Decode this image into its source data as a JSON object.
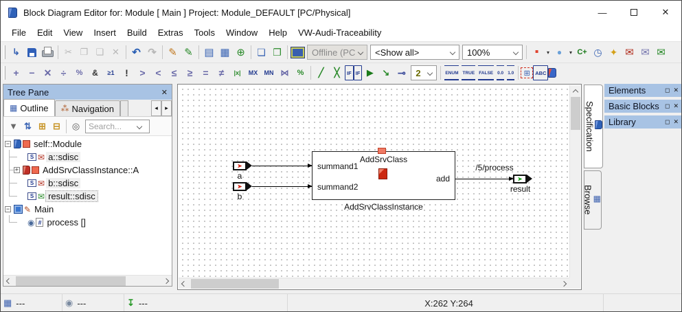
{
  "window": {
    "title": "Block Diagram Editor for: Module [ Main ] Project: Module_DEFAULT [PC/Physical]",
    "controls": {
      "minimize": "—",
      "close": "✕"
    }
  },
  "menu": {
    "items": [
      {
        "label": "File",
        "name": "menu-file"
      },
      {
        "label": "Edit",
        "name": "menu-edit"
      },
      {
        "label": "View",
        "name": "menu-view"
      },
      {
        "label": "Insert",
        "name": "menu-insert"
      },
      {
        "label": "Build",
        "name": "menu-build"
      },
      {
        "label": "Extras",
        "name": "menu-extras"
      },
      {
        "label": "Tools",
        "name": "menu-tools"
      },
      {
        "label": "Window",
        "name": "menu-window"
      },
      {
        "label": "Help",
        "name": "menu-help"
      },
      {
        "label": "VW-Audi-Traceability",
        "name": "menu-vw-audi-traceability"
      }
    ]
  },
  "toolbar_main": {
    "items_left": [
      {
        "cls": "grip",
        "name": "toolbar-grip",
        "act": "false"
      },
      {
        "cls": "tbi",
        "name": "show-in-browser-icon",
        "glyph": "↳",
        "style": "color:#3a64b4;font-weight:bold"
      },
      {
        "cls": "tbi ic-floppy",
        "name": "save-icon",
        "glyph": ""
      },
      {
        "cls": "tbi ic-print",
        "name": "print-icon",
        "glyph": ""
      },
      {
        "cls": "tbsep",
        "name": "toolbar-separator",
        "act": "false"
      },
      {
        "cls": "tbi dis",
        "name": "cut-icon",
        "glyph": "✂"
      },
      {
        "cls": "tbi dis",
        "name": "copy-icon",
        "glyph": "❐"
      },
      {
        "cls": "tbi dis",
        "name": "paste-icon",
        "glyph": "❏"
      },
      {
        "cls": "tbi dis",
        "name": "delete-icon",
        "glyph": "✕"
      },
      {
        "cls": "tbsep",
        "name": "toolbar-separator",
        "act": "false"
      },
      {
        "cls": "tbi",
        "name": "undo-icon",
        "glyph": "↶",
        "style": "color:#2a5fb4;font-weight:bold;font-size:15px"
      },
      {
        "cls": "tbi dis",
        "name": "redo-icon",
        "glyph": "↷",
        "style": "font-weight:bold;font-size:15px"
      },
      {
        "cls": "tbsep",
        "name": "toolbar-separator",
        "act": "false"
      },
      {
        "cls": "tbi",
        "name": "edit-component-icon",
        "glyph": "✎",
        "style": "color:#c07820;font-size:15px"
      },
      {
        "cls": "tbi",
        "name": "edit-data-icon",
        "glyph": "✎",
        "style": "color:#2a8a2a;font-size:15px"
      },
      {
        "cls": "tbsep",
        "name": "toolbar-separator",
        "act": "false"
      },
      {
        "cls": "tbi",
        "name": "add-database-item-icon",
        "glyph": "▤",
        "style": "color:#3a64b4;font-size:15px"
      },
      {
        "cls": "tbi",
        "name": "add-module-icon",
        "glyph": "▦",
        "style": "color:#3a64b4;font-size:15px"
      },
      {
        "cls": "tbi",
        "name": "add-class-icon",
        "glyph": "⊕",
        "style": "color:#2a8a2a;font-size:15px"
      },
      {
        "cls": "tbsep",
        "name": "toolbar-separator",
        "act": "false"
      },
      {
        "cls": "tbi",
        "name": "open-specification-icon",
        "glyph": "❏",
        "style": "color:#3a64b4;font-size:14px"
      },
      {
        "cls": "tbi",
        "name": "generate-code-icon",
        "glyph": "❐",
        "style": "color:#2a8a2a;font-size:14px"
      },
      {
        "cls": "tbsep",
        "name": "toolbar-separator",
        "act": "false"
      },
      {
        "cls": "tbi ic-monitor",
        "name": "experiment-monitor-icon",
        "glyph": ""
      }
    ],
    "combos": {
      "target": {
        "value": "Offline (PC",
        "name": "experiment-target-combo"
      },
      "filter": {
        "value": "<Show all>",
        "name": "filter-combo"
      },
      "zoom": {
        "value": "100%",
        "name": "zoom-combo"
      }
    },
    "items_right": [
      {
        "cls": "tbsep",
        "name": "toolbar-separator",
        "act": "false"
      },
      {
        "cls": "tbi",
        "name": "add-discrete-element-icon",
        "glyph": "▪",
        "style": "color:#e04430;font-size:16px"
      },
      {
        "cls": "tbdd",
        "name": "dropdown-arrow-icon",
        "glyph": "▾"
      },
      {
        "cls": "tbi",
        "name": "add-continuous-element-icon",
        "glyph": "●",
        "style": "color:#6aa0d8;font-size:12px"
      },
      {
        "cls": "tbdd",
        "name": "dropdown-arrow-icon",
        "glyph": "▾"
      },
      {
        "cls": "tbi",
        "name": "add-constant-icon",
        "glyph": "C+",
        "style": "color:#1a7a1a;font-weight:bold;font-size:11px"
      },
      {
        "cls": "tbi",
        "name": "add-timer-icon",
        "glyph": "◷",
        "style": "color:#3a64b4;font-size:14px"
      },
      {
        "cls": "tbi",
        "name": "add-resource-icon",
        "glyph": "✦",
        "style": "color:#d4a017;font-size:14px"
      },
      {
        "cls": "tbi",
        "name": "receive-message-icon",
        "glyph": "✉",
        "style": "color:#b23020;font-size:15px"
      },
      {
        "cls": "tbi",
        "name": "message-icon",
        "glyph": "✉",
        "style": "color:#7a7ab0;font-size:15px"
      },
      {
        "cls": "tbi",
        "name": "send-message-icon",
        "glyph": "✉",
        "style": "color:#2a8a2a;font-size:15px"
      }
    ]
  },
  "toolbar_ops": {
    "items_left": [
      {
        "cls": "grip",
        "name": "toolbar-grip",
        "act": "false"
      },
      {
        "cls": "tbi op",
        "name": "add-operator-icon",
        "glyph": "+"
      },
      {
        "cls": "tbi op",
        "name": "subtract-operator-icon",
        "glyph": "−"
      },
      {
        "cls": "tbi op",
        "name": "multiply-operator-icon",
        "glyph": "✕"
      },
      {
        "cls": "tbi op",
        "name": "divide-operator-icon",
        "glyph": "÷"
      },
      {
        "cls": "tbi op",
        "name": "modulo-operator-icon",
        "glyph": "%",
        "style": "font-size:11px"
      },
      {
        "cls": "tbi",
        "name": "and-operator-icon",
        "glyph": "&",
        "style": "font-weight:bold;font-size:12px"
      },
      {
        "cls": "tbi optxt",
        "name": "or-operator-icon",
        "glyph": "≥1"
      },
      {
        "cls": "tbi op",
        "name": "not-operator-icon",
        "glyph": "!",
        "style": "color:#333"
      },
      {
        "cls": "tbi op",
        "name": "greater-operator-icon",
        "glyph": ">"
      },
      {
        "cls": "tbi op",
        "name": "less-operator-icon",
        "glyph": "<"
      },
      {
        "cls": "tbi op",
        "name": "less-equal-operator-icon",
        "glyph": "≤"
      },
      {
        "cls": "tbi op",
        "name": "greater-equal-operator-icon",
        "glyph": "≥"
      },
      {
        "cls": "tbi op",
        "name": "equal-operator-icon",
        "glyph": "="
      },
      {
        "cls": "tbi op",
        "name": "not-equal-operator-icon",
        "glyph": "≠"
      },
      {
        "cls": "tbi optxt",
        "name": "abs-operator-icon",
        "glyph": "|x|",
        "style": "color:#2a8a2a"
      },
      {
        "cls": "tbi optxt",
        "name": "max-operator-icon",
        "glyph": "MX"
      },
      {
        "cls": "tbi optxt",
        "name": "min-operator-icon",
        "glyph": "MN"
      },
      {
        "cls": "tbi op",
        "name": "limiter-icon",
        "glyph": "⋈",
        "style": "font-size:12px"
      },
      {
        "cls": "tbi op",
        "name": "percent-case-icon",
        "glyph": "%",
        "style": "color:#2a8a2a;font-size:11px"
      },
      {
        "cls": "tbsep",
        "name": "toolbar-separator",
        "act": "false"
      },
      {
        "cls": "tbi",
        "name": "switch-icon",
        "glyph": "╱",
        "style": "color:#2a8a2a;font-weight:bold"
      },
      {
        "cls": "tbi",
        "name": "case-icon",
        "glyph": "╳",
        "style": "color:#2a8a2a;font-weight:bold"
      },
      {
        "cls": "tbi tbtag",
        "name": "if-then-icon",
        "glyph": "IF"
      },
      {
        "cls": "tbi tbtag",
        "name": "if-then-else-icon",
        "glyph": "IF"
      },
      {
        "cls": "tbi",
        "name": "diagram-play-icon",
        "glyph": "▶",
        "style": "color:#1a7a1a"
      },
      {
        "cls": "tbi",
        "name": "connector-icon",
        "glyph": "↘",
        "style": "color:#2a8a2a;font-weight:bold"
      },
      {
        "cls": "tbi",
        "name": "terminate-icon",
        "glyph": "⊸",
        "style": "color:#3a4a9a;font-weight:bold;font-size:14px"
      }
    ],
    "block_size": {
      "value": "2",
      "name": "block-size-combo"
    },
    "items_right": [
      {
        "cls": "tbsep",
        "name": "toolbar-separator",
        "act": "false"
      },
      {
        "cls": "tbi tbport",
        "name": "enum-literal-icon",
        "glyph": "ENUM"
      },
      {
        "cls": "tbi tbport",
        "name": "true-literal-icon",
        "glyph": "TRUE"
      },
      {
        "cls": "tbi tbport",
        "name": "false-literal-icon",
        "glyph": "FALSE"
      },
      {
        "cls": "tbi tbport",
        "name": "zero-literal-icon",
        "glyph": "0.0"
      },
      {
        "cls": "tbi tbport",
        "name": "one-literal-icon",
        "glyph": "1.0"
      },
      {
        "cls": "tbsep",
        "name": "toolbar-separator",
        "act": "false"
      },
      {
        "cls": "tbi hier",
        "name": "hierarchy-icon",
        "glyph": "⊞",
        "style": "color:#3a64b4"
      },
      {
        "cls": "tbi tbtag",
        "name": "comment-icon",
        "glyph": "ABC"
      },
      {
        "cls": "tbi ic-book",
        "name": "protected-component-icon",
        "glyph": ""
      }
    ]
  },
  "tree_pane": {
    "title": "Tree Pane",
    "close_glyph": "✕",
    "tabs": {
      "outline": "Outline",
      "navigation": "Navigation"
    },
    "tab_icons": {
      "outline": "▦",
      "navigation": "⁂"
    },
    "search_placeholder": "Search...",
    "toolbar": [
      {
        "cls": "tbi sm",
        "name": "filter-icon",
        "glyph": "▼",
        "style": "color:#6a6a6a"
      },
      {
        "cls": "tbi sm",
        "name": "sort-az-icon",
        "glyph": "⇅",
        "style": "color:#3a64b4;font-weight:bold"
      },
      {
        "cls": "tbi sm",
        "name": "expand-all-icon",
        "glyph": "⊞",
        "style": "color:#c8962a;font-weight:bold"
      },
      {
        "cls": "tbi sm",
        "name": "collapse-all-icon",
        "glyph": "⊟",
        "style": "color:#c8962a;font-weight:bold"
      },
      {
        "cls": "tbsep",
        "name": "toolbar-separator",
        "act": "false"
      },
      {
        "cls": "tbi sm",
        "name": "find-icon",
        "glyph": "◎",
        "style": "color:#555"
      }
    ],
    "items": [
      {
        "cls": "trow d0",
        "name": "tree-item-self-module",
        "ex": "−",
        "excls": "texp",
        "i1cls": "ti ti-book",
        "i1name": "module-icon",
        "i2cls": "ti ti-sq",
        "i2name": "element-icon",
        "label": "self::Module"
      },
      {
        "cls": "trow d1 hl",
        "name": "tree-item-a",
        "ex": "",
        "excls": "texp none",
        "i1cls": "ti ti-s",
        "i1g": "S",
        "i1name": "signal-port-icon",
        "i2cls": "ti",
        "i2g": "✉",
        "i2s": "color:#b23020",
        "i2name": "receive-message-icon",
        "label": "a::sdisc"
      },
      {
        "cls": "trow d1x",
        "name": "tree-item-addsrvclassinstance",
        "ex": "+",
        "excls": "texp",
        "i1cls": "ti ti-book r",
        "i1name": "class-icon",
        "i2cls": "ti ti-sq",
        "i2name": "element-icon",
        "label": "AddSrvClassInstance::A"
      },
      {
        "cls": "trow d1 hl",
        "name": "tree-item-b",
        "ex": "",
        "excls": "texp none",
        "i1cls": "ti ti-s",
        "i1g": "S",
        "i1name": "signal-port-icon",
        "i2cls": "ti",
        "i2g": "✉",
        "i2s": "color:#b23020",
        "i2name": "receive-message-icon",
        "label": "b::sdisc"
      },
      {
        "cls": "trow d1 hl focus",
        "name": "tree-item-result",
        "ex": "",
        "excls": "texp none",
        "i1cls": "ti ti-s",
        "i1g": "S",
        "i1name": "signal-port-icon",
        "i2cls": "ti",
        "i2g": "✉",
        "i2s": "color:#2a8a2a",
        "i2name": "send-message-icon",
        "label": "result::sdisc"
      },
      {
        "cls": "trow d0",
        "name": "tree-item-main",
        "ex": "−",
        "excls": "texp",
        "i1cls": "ti ti-diag",
        "i1name": "diagram-icon",
        "i2cls": "ti",
        "i2g": "✎",
        "i2s": "color:#b04a20",
        "i2name": "edit-page-icon",
        "label": "Main"
      },
      {
        "cls": "trow d1",
        "name": "tree-item-process",
        "ex": "",
        "excls": "texp none",
        "i1cls": "ti",
        "i1g": "◉",
        "i1s": "color:#4a6a9a",
        "i1name": "process-icon",
        "i2cls": "ti ti-hash",
        "i2g": "#",
        "i2name": "hash-icon",
        "label": "process []"
      }
    ]
  },
  "canvas": {
    "block": {
      "class_name": "AddSrvClass",
      "instance_name": "AddSrvClassInstance",
      "input1": "summand1",
      "input2": "summand2",
      "output": "add"
    },
    "ports": {
      "input1_label": "a",
      "input2_label": "b",
      "output_label": "result"
    },
    "wire_label": "/5/process",
    "port_arrow_glyph": "➤"
  },
  "right_tabs": {
    "specification": "Specification",
    "browse": "Browse",
    "browse_icon": "▦"
  },
  "right_panels": [
    {
      "title": "Elements"
    },
    {
      "title": "Basic Blocks"
    },
    {
      "title": "Library"
    }
  ],
  "panel_controls": {
    "dock": "◻",
    "close": "✕"
  },
  "status_bar": {
    "cells": [
      {
        "name": "status-outline-field",
        "icon": "grid-icon",
        "glyph": "▦",
        "iconstyle": "color:#3a5fae",
        "value": "---",
        "style": "width:90px"
      },
      {
        "name": "status-build-field",
        "icon": "sphere-icon",
        "glyph": "◉",
        "iconstyle": "color:#7a8aa0",
        "value": "---",
        "style": "width:90px"
      },
      {
        "name": "status-codegen-field",
        "icon": "download-icon",
        "glyph": "↧",
        "iconstyle": "color:#2a9a2a;font-weight:bold",
        "value": "---",
        "style": "width:238px"
      },
      {
        "name": "status-coordinates",
        "icon": "",
        "glyph": "",
        "iconstyle": "",
        "value": "X:262 Y:264",
        "style": "width:460px;justify-content:center"
      },
      {
        "name": "status-extra",
        "icon": "",
        "glyph": "",
        "iconstyle": "",
        "value": "",
        "style": "flex:1;border-right:none"
      }
    ]
  }
}
